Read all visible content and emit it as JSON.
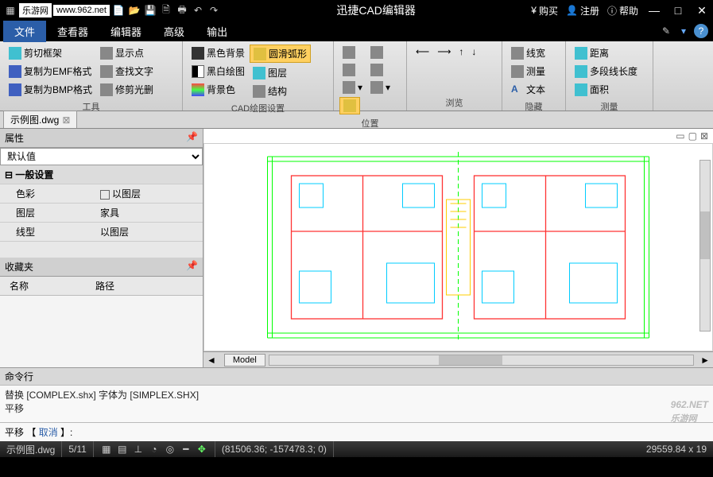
{
  "titlebar": {
    "site_label": "乐游网",
    "url": "www.962.net",
    "title": "迅捷CAD编辑器",
    "buy": "购买",
    "register": "注册",
    "help": "帮助"
  },
  "menu": {
    "tabs": [
      "文件",
      "查看器",
      "编辑器",
      "高级",
      "输出"
    ],
    "active_index": 0
  },
  "ribbon": {
    "groups": [
      {
        "label": "工具",
        "items": [
          "剪切框架",
          "复制为EMF格式",
          "复制为BMP格式",
          "显示点",
          "查找文字",
          "修剪光删"
        ]
      },
      {
        "label": "CAD绘图设置",
        "items": [
          "黑色背景",
          "黑白绘图",
          "背景色",
          "圆滑弧形",
          "图层",
          "结构"
        ],
        "highlighted_index": 3
      },
      {
        "label": "位置",
        "items": []
      },
      {
        "label": "浏览",
        "items": []
      },
      {
        "label": "隐藏",
        "items": [
          "线宽",
          "测量",
          "文本"
        ]
      },
      {
        "label": "测量",
        "items": [
          "距离",
          "多段线长度",
          "面积"
        ]
      }
    ]
  },
  "doc_tabs": [
    {
      "name": "示例图.dwg"
    }
  ],
  "props": {
    "title": "属性",
    "combo": "默认值",
    "category": "一般设置",
    "rows": [
      {
        "key": "色彩",
        "val_checkbox": true,
        "val": "以图层"
      },
      {
        "key": "图层",
        "val": "家具"
      },
      {
        "key": "线型",
        "val": "以图层"
      }
    ]
  },
  "favorites": {
    "title": "收藏夹",
    "cols": [
      "名称",
      "路径"
    ]
  },
  "canvas": {
    "model_tab": "Model"
  },
  "cmd": {
    "title": "命令行",
    "log": [
      "替换 [COMPLEX.shx] 字体为 [SIMPLEX.SHX]",
      "平移"
    ],
    "prompt": "平移 【",
    "cancel": "取消",
    "suffix": "】:"
  },
  "status": {
    "file": "示例图.dwg",
    "layer": "5/11",
    "coords": "(81506.36; -157478.3; 0)",
    "right": "29559.84 x 19"
  },
  "watermark": {
    "big": "962.NET",
    "small": "乐游网"
  }
}
